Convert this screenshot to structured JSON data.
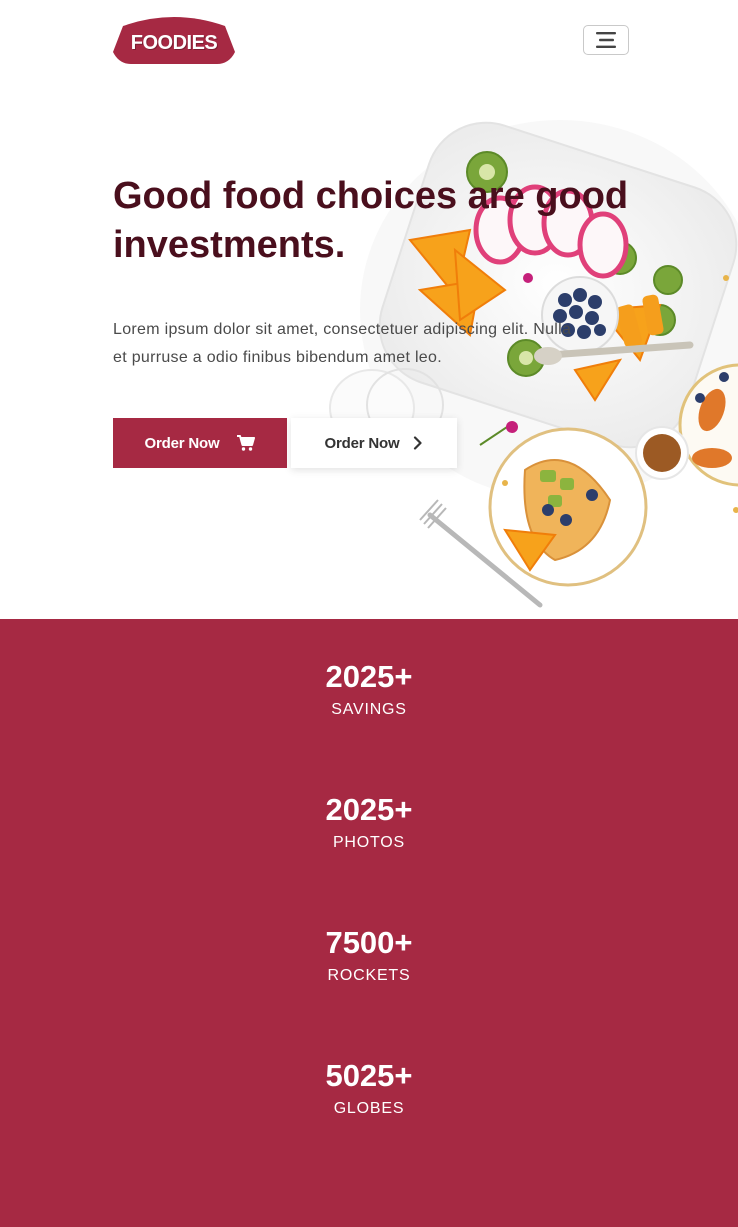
{
  "brand": {
    "name": "FOODIES",
    "color": "#a62943",
    "title_color": "#4a0f1d"
  },
  "nav": {
    "toggle_icon": "hamburger-icon"
  },
  "hero": {
    "title_line1": "Good food choices are good",
    "title_line2": "investments.",
    "text_line1": "Lorem ipsum dolor sit amet, consectetuer adipiscing elit. Nulla",
    "text_line2": "et purruse a odio finibus bibendum amet leo.",
    "primary_button": {
      "label": "Order Now",
      "icon": "cart-icon"
    },
    "secondary_button": {
      "label": "Order Now",
      "icon": "chevron-right-icon"
    }
  },
  "stats": [
    {
      "value": "2025+",
      "label": "SAVINGS"
    },
    {
      "value": "2025+",
      "label": "PHOTOS"
    },
    {
      "value": "7500+",
      "label": "ROCKETS"
    },
    {
      "value": "5025+",
      "label": "GLOBES"
    }
  ]
}
